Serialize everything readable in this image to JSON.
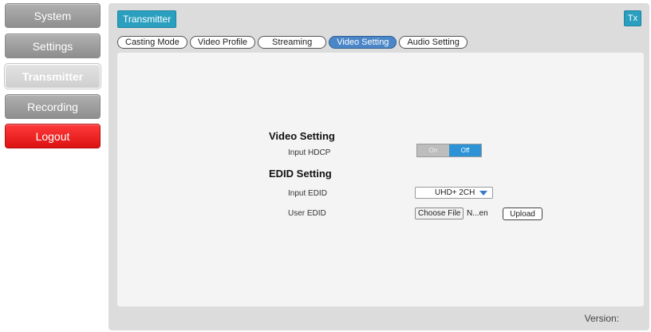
{
  "nav": {
    "items": [
      {
        "label": "System"
      },
      {
        "label": "Settings"
      },
      {
        "label": "Transmitter"
      },
      {
        "label": "Recording"
      },
      {
        "label": "Logout"
      }
    ]
  },
  "header": {
    "title": "Transmitter",
    "badge": "Tx"
  },
  "tabs": [
    {
      "label": "Casting Mode"
    },
    {
      "label": "Video Profile"
    },
    {
      "label": "Streaming"
    },
    {
      "label": "Video Setting"
    },
    {
      "label": "Audio Setting"
    }
  ],
  "video_setting": {
    "title": "Video Setting",
    "input_hdcp_label": "Input HDCP",
    "toggle_on_label": "On",
    "toggle_off_label": "Off"
  },
  "edid_setting": {
    "title": "EDID Setting",
    "input_edid_label": "Input EDID",
    "input_edid_value": "UHD+ 2CH",
    "user_edid_label": "User EDID",
    "choose_file_label": "Choose File",
    "file_name": "N...en",
    "upload_label": "Upload"
  },
  "footer": {
    "version_label": "Version:"
  },
  "colors": {
    "accent": "#2a9fbf",
    "active_tab": "#4a86c8",
    "logout": "#e41b1b",
    "toggle_active": "#2d93d6"
  }
}
